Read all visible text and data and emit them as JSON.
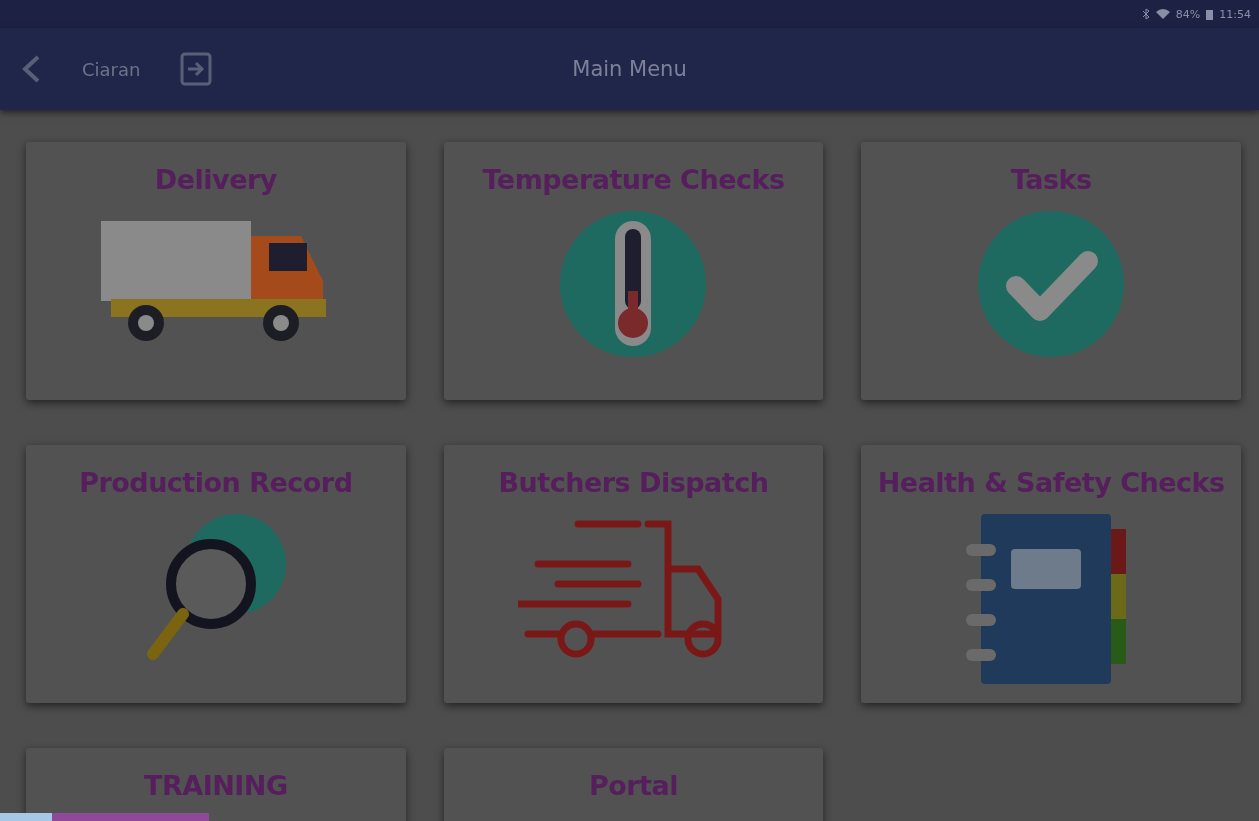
{
  "status_bar": {
    "battery": "84%",
    "time": "11:54"
  },
  "header": {
    "user": "Ciaran",
    "title": "Main Menu"
  },
  "tiles": [
    {
      "label": "Delivery",
      "kind": "delivery"
    },
    {
      "label": "Temperature Checks",
      "kind": "thermometer"
    },
    {
      "label": "Tasks",
      "kind": "check"
    },
    {
      "label": "Production Record",
      "kind": "magnifier"
    },
    {
      "label": "Butchers Dispatch",
      "kind": "fast-truck"
    },
    {
      "label": "Health & Safety Checks",
      "kind": "notebook"
    },
    {
      "label": "TRAINING",
      "kind": "none"
    },
    {
      "label": "Portal",
      "kind": "none"
    }
  ]
}
